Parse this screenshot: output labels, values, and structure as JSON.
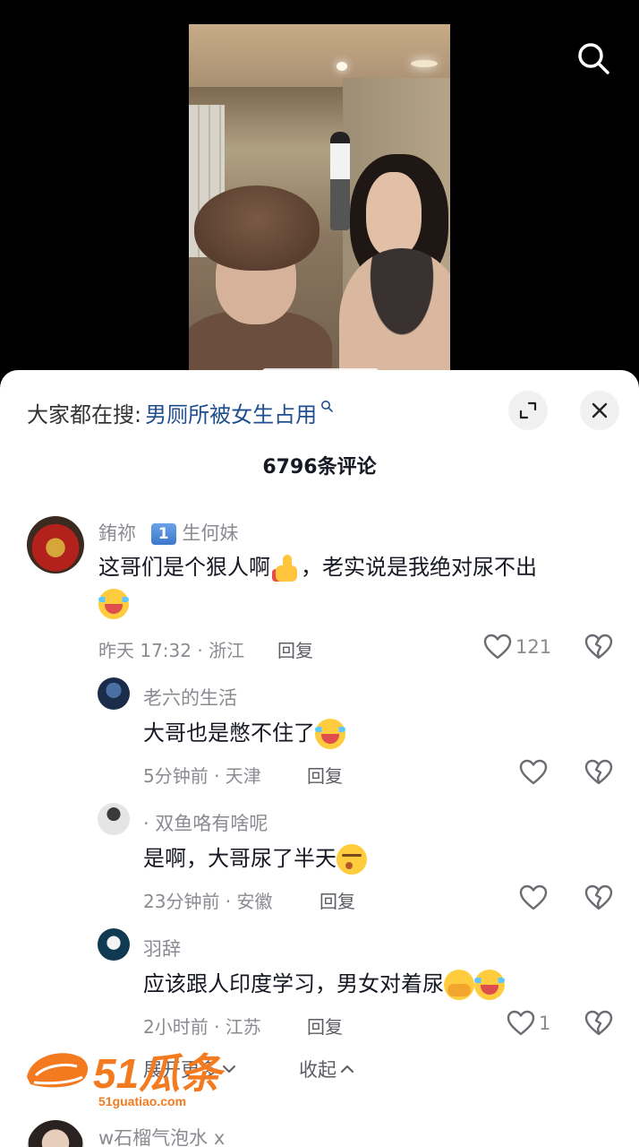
{
  "video": {
    "caption": ""
  },
  "search_button_icon": "search-icon",
  "trending": {
    "prefix": "大家都在搜:",
    "query": "男厕所被女生占用",
    "search_icon": "search-icon"
  },
  "sheet_buttons": {
    "expand_icon": "expand-icon",
    "close_icon": "close-icon"
  },
  "comment_count": "6796条评论",
  "comments": [
    {
      "username": "銪祢",
      "badge_number": "1",
      "badge_text": "生何妹",
      "text": "这哥们是个狠人啊",
      "text_after_emoji": "，老实说是我绝对尿不出",
      "emoji_1": "thumbs-up-emoji",
      "emoji_2": "laughing-crying-emoji",
      "time": "昨天 17:32 · 浙江",
      "reply": "回复",
      "likes": "121"
    }
  ],
  "replies": [
    {
      "username": "老六的生活",
      "text": "大哥也是憋不住了",
      "emoji": "laughing-crying-emoji",
      "time": "5分钟前 · 天津",
      "reply": "回复",
      "likes": ""
    },
    {
      "username": "· 双鱼咯有啥呢",
      "text": "是啊，大哥尿了半天",
      "emoji": "sigh-emoji",
      "time": "23分钟前 · 安徽",
      "reply": "回复",
      "likes": ""
    },
    {
      "username": "羽辞",
      "text": "应该跟人印度学习，男女对着尿",
      "emoji": "hands-over-mouth-emoji",
      "emoji_2": "laughing-crying-emoji",
      "time": "2小时前 · 江苏",
      "reply": "回复",
      "likes": "1"
    }
  ],
  "expand_more": "展开更多",
  "collapse": "收起",
  "next_comment": {
    "username": "w石榴气泡水 x"
  },
  "watermark": {
    "main": "51瓜条",
    "url": "51guatiao.com"
  },
  "colors": {
    "link": "#1f4f8f",
    "muted": "#8a8b91",
    "text": "#161823",
    "watermark": "#f47a20"
  }
}
